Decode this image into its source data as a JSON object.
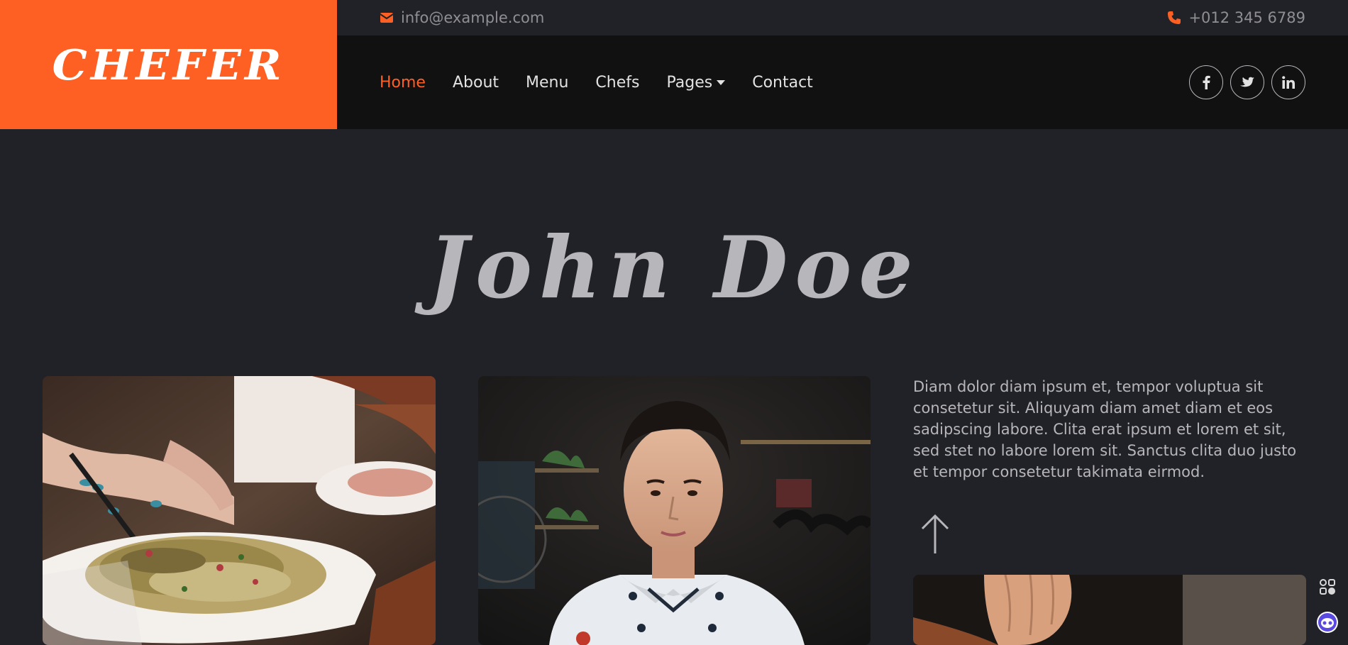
{
  "brand": {
    "name": "CHEFER",
    "color": "#fe5f22"
  },
  "topbar": {
    "email": "info@example.com",
    "phone": "+012 345 6789",
    "email_icon": "envelope-icon",
    "phone_icon": "phone-icon"
  },
  "nav": {
    "items": [
      {
        "label": "Home",
        "active": true
      },
      {
        "label": "About"
      },
      {
        "label": "Menu"
      },
      {
        "label": "Chefs"
      },
      {
        "label": "Pages",
        "dropdown": true
      },
      {
        "label": "Contact"
      }
    ],
    "socials": [
      {
        "name": "facebook-icon",
        "glyph": "f"
      },
      {
        "name": "twitter-icon",
        "glyph": "t"
      },
      {
        "name": "linkedin-icon",
        "glyph": "in"
      }
    ]
  },
  "hero": {
    "title": "John Doe"
  },
  "content": {
    "description": "Diam dolor diam ipsum et, tempor voluptua sit consetetur sit. Aliquyam diam amet diam et eos sadipscing labore. Clita erat ipsum et lorem et sit, sed stet no labore lorem sit. Sanctus clita duo justo et tempor consetetur takimata eirmod."
  },
  "colors": {
    "accent": "#fe5f22",
    "background": "#212227",
    "navbar": "#111112"
  }
}
